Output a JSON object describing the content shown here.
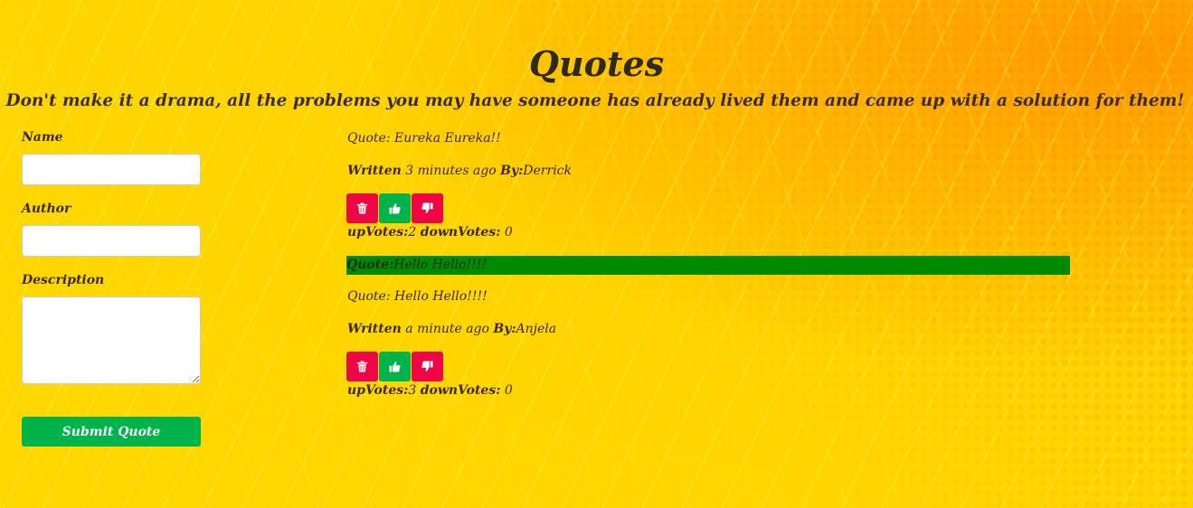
{
  "header": {
    "title": "Quotes",
    "tagline": "Don't make it a drama, all the problems you may have someone has already lived them and came up with a solution for them!"
  },
  "form": {
    "name_label": "Name",
    "name_value": "",
    "author_label": "Author",
    "author_value": "",
    "description_label": "Description",
    "description_value": "",
    "submit_label": "Submit Quote"
  },
  "quotes": [
    {
      "text": "Quote: Eureka Eureka!!",
      "written_label": "Written",
      "time": "3 minutes ago",
      "by_label": "By:",
      "author": "Derrick",
      "upvotes_label": "upVotes:",
      "upvotes": "2",
      "downvotes_label": "downVotes:",
      "downvotes": "0"
    },
    {
      "text": "Quote: Hello Hello!!!!",
      "written_label": "Written",
      "time": "a minute ago",
      "by_label": "By:",
      "author": "Anjela",
      "upvotes_label": "upVotes:",
      "upvotes": "3",
      "downvotes_label": "downVotes:",
      "downvotes": "0"
    }
  ],
  "highlight": {
    "label": "Quote:",
    "text": "Hello Hello!!!!",
    "color": "#008a00"
  },
  "icons": {
    "delete": "trash-icon",
    "upvote": "thumbs-up-icon",
    "downvote": "thumbs-down-icon"
  },
  "colors": {
    "delete": "#ee0645",
    "upvote": "#00b34a",
    "downvote": "#ee0645",
    "submit": "#00b34a"
  }
}
